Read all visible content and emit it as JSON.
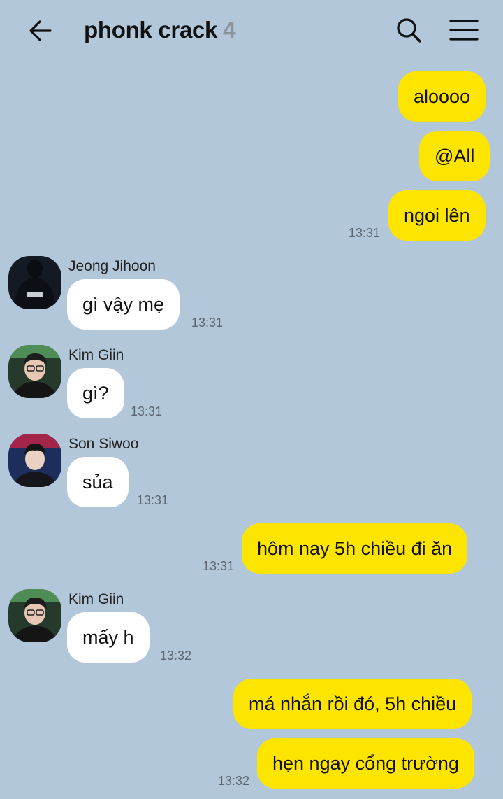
{
  "header": {
    "title": "phonk crack",
    "member_count": "4"
  },
  "messages": [
    {
      "id": "m1",
      "text": "aloooo",
      "from": "me"
    },
    {
      "id": "m2",
      "text": "@All",
      "from": "me"
    },
    {
      "id": "m3",
      "text": "ngoi lên",
      "from": "me",
      "time": "13:31"
    },
    {
      "id": "m4",
      "sender": "Jeong Jihoon",
      "text": "gì vậy mẹ",
      "time": "13:31"
    },
    {
      "id": "m5",
      "sender": "Kim Giin",
      "text": "gì?",
      "time": "13:31"
    },
    {
      "id": "m6",
      "sender": "Son Siwoo",
      "text": "sủa",
      "time": "13:31"
    },
    {
      "id": "m7",
      "text": "hôm nay 5h chiều đi ăn",
      "from": "me",
      "time": "13:31"
    },
    {
      "id": "m8",
      "sender": "Kim Giin",
      "text": "mấy h",
      "time": "13:32"
    },
    {
      "id": "m9",
      "text": "má nhắn rồi đó, 5h chiều",
      "from": "me"
    },
    {
      "id": "m10",
      "text": "hẹn ngay cổng trường",
      "from": "me",
      "time": "13:32"
    }
  ],
  "colors": {
    "background": "#b2c7da",
    "my_bubble": "#fee500",
    "their_bubble": "#ffffff"
  },
  "icons": {
    "back": "arrow-left-icon",
    "search": "search-icon",
    "menu": "hamburger-menu-icon"
  }
}
